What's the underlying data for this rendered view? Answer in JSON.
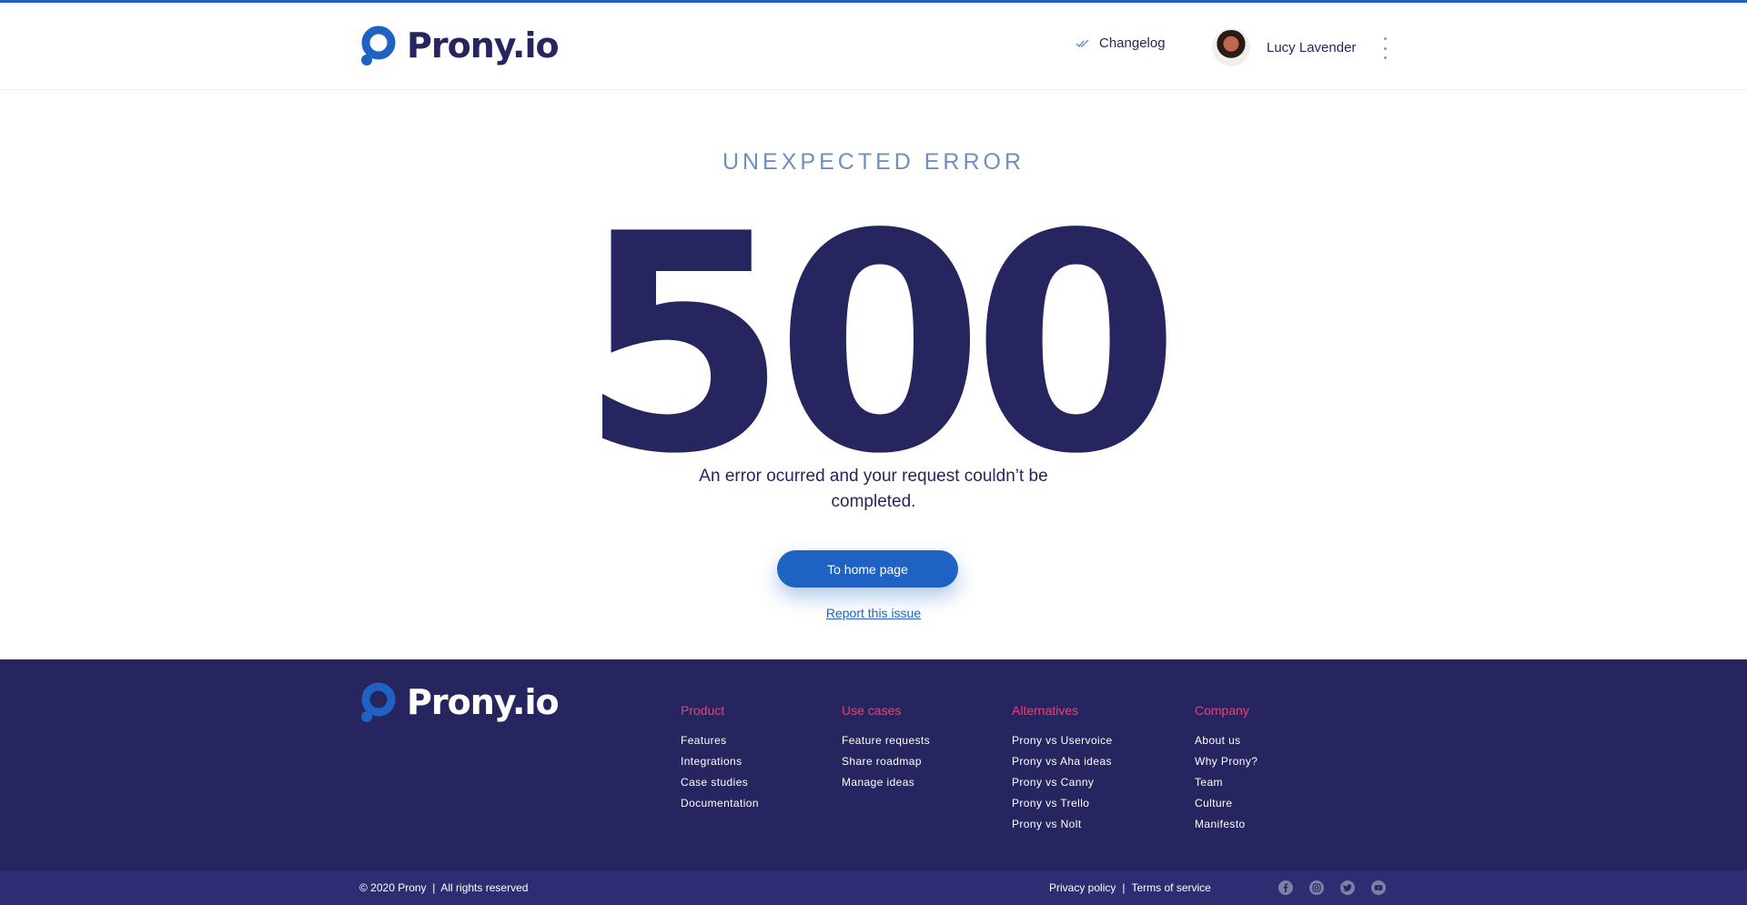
{
  "header": {
    "logo_text": "Prony.io",
    "changelog_label": "Changelog",
    "user_name": "Lucy Lavender"
  },
  "error": {
    "eyebrow": "UNEXPECTED ERROR",
    "code": "500",
    "message": "An error ocurred and your request couldn’t be completed.",
    "home_button": "To home page",
    "report_link": "Report this issue"
  },
  "footer": {
    "logo_text": "Prony.io",
    "columns": [
      {
        "title": "Product",
        "items": [
          "Features",
          "Integrations",
          "Case studies",
          "Documentation"
        ]
      },
      {
        "title": "Use cases",
        "items": [
          "Feature requests",
          "Share roadmap",
          "Manage ideas"
        ]
      },
      {
        "title": "Alternatives",
        "items": [
          "Prony vs Uservoice",
          "Prony vs Aha ideas",
          "Prony vs Canny",
          "Prony vs Trello",
          "Prony vs Nolt"
        ]
      },
      {
        "title": "Company",
        "items": [
          "About us",
          "Why Prony?",
          "Team",
          "Culture",
          "Manifesto"
        ]
      }
    ],
    "copyright": "© 2020 Prony",
    "rights": "All rights reserved",
    "separator": "|",
    "privacy": "Privacy policy",
    "terms": "Terms of service",
    "socials": [
      "facebook-icon",
      "instagram-icon",
      "twitter-icon",
      "youtube-icon"
    ]
  },
  "colors": {
    "brand_blue": "#1e63c4",
    "navy": "#272560",
    "footer_heading": "#f23d6d",
    "eyebrow": "#6f8fc3"
  }
}
